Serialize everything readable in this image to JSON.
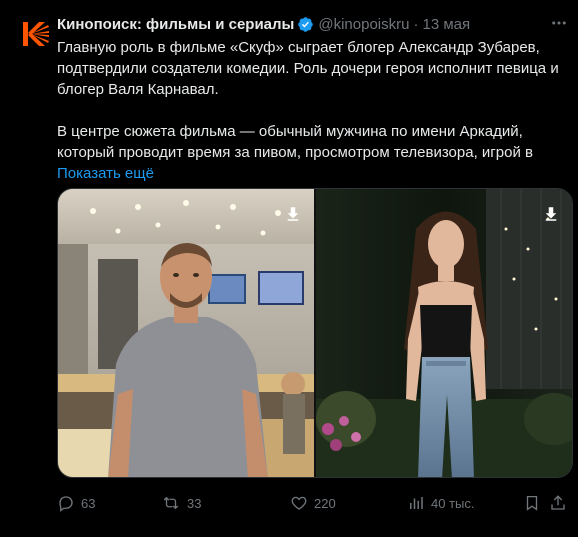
{
  "author": {
    "name": "Кинопоиск: фильмы и сериалы",
    "handle": "@kinopoiskru",
    "separator": "·",
    "date": "13 мая",
    "logo_color": "#ff5500"
  },
  "text": {
    "lines": [
      "Главную роль в фильме «Скуф» сыграет блогер Александр Зубарев,",
      "подтвердили создатели комедии. Роль дочери героя исполнит певица и",
      "блогер Валя Карнавал.",
      "В центре сюжета фильма — обычный мужчина по имени Аркадий,",
      "который проводит время за пивом, просмотром телевизора, игрой в"
    ],
    "show_more": "Показать ещё"
  },
  "media": {
    "photos": [
      {
        "icon": "download-icon"
      },
      {
        "icon": "download-icon"
      }
    ]
  },
  "actions": {
    "replies": "63",
    "reposts": "33",
    "likes": "220",
    "views": "40 тыс."
  },
  "colors": {
    "background": "#000000",
    "text": "#e7e9ea",
    "muted": "#71767b",
    "link": "#1d9bf0",
    "verified": "#1d9bf0"
  }
}
